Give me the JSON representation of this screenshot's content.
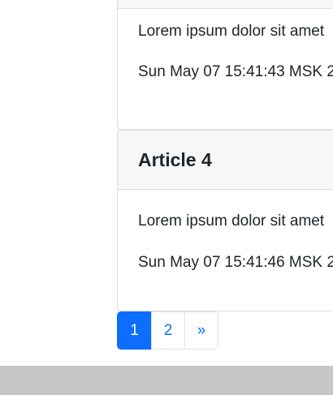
{
  "cards": [
    {
      "title": "",
      "text": "Lorem ipsum dolor sit amet",
      "date": "Sun May 07 15:41:43 MSK 2"
    },
    {
      "title": "Article 4",
      "text": "Lorem ipsum dolor sit amet",
      "date": "Sun May 07 15:41:46 MSK 2"
    }
  ],
  "pagination": {
    "pages": [
      "1",
      "2"
    ],
    "next": "»",
    "active_page": "1"
  },
  "colors": {
    "accent": "#0d6efd",
    "card_header_bg": "#f7f7f7",
    "border": "#dfdfdf",
    "bottom_bar": "#c7c7c9",
    "text": "#212529"
  }
}
